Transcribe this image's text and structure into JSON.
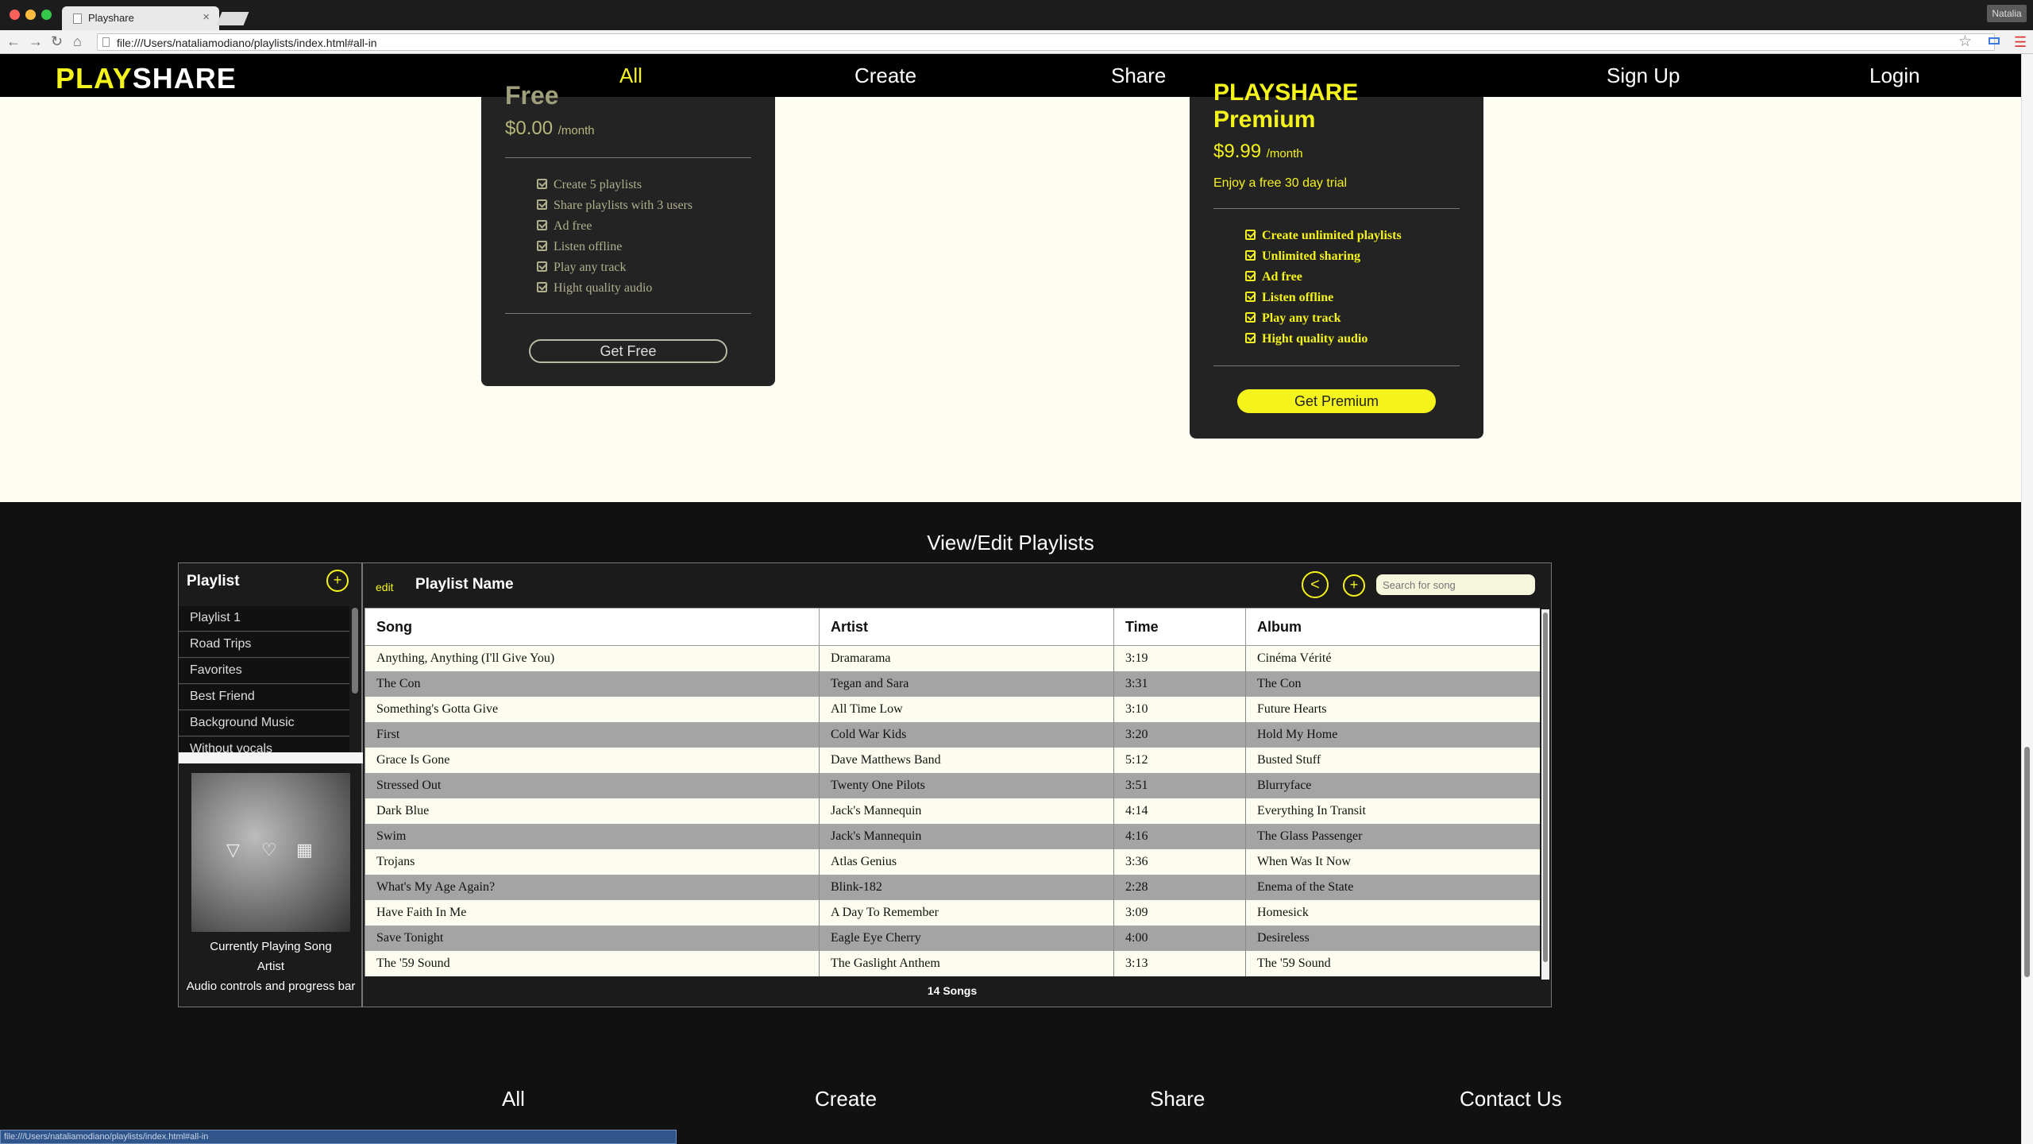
{
  "browser": {
    "tab_title": "Playshare",
    "tab_close": "×",
    "url": "file:///Users/nataliamodiano/playlists/index.html#all-in",
    "profile_name": "Natalia",
    "back_icon": "←",
    "forward_icon": "→",
    "reload_icon": "↻",
    "home_icon": "⌂",
    "star_icon": "☆",
    "menu_icon": "☰",
    "status_url": "file:///Users/nataliamodiano/playlists/index.html#all-in"
  },
  "nav": {
    "logo_part1": "PLAY",
    "logo_part2": "SHARE",
    "links": [
      "All",
      "Create",
      "Share"
    ],
    "signup": "Sign Up",
    "login": "Login",
    "active_color": "#f4f31c"
  },
  "pricing": {
    "free": {
      "title": "Free",
      "price": "$0.00",
      "period": "/month",
      "features": [
        "Create 5 playlists",
        "Share playlists with 3 users",
        "Ad free",
        "Listen offline",
        "Play any track",
        "Hight quality audio"
      ],
      "button": "Get Free"
    },
    "premium": {
      "title_line1": "PLAYSHARE",
      "title_line2": "Premium",
      "price": "$9.99",
      "period": "/month",
      "trial": "Enjoy a free 30 day trial",
      "features": [
        "Create unlimited playlists",
        "Unlimited sharing",
        "Ad free",
        "Listen offline",
        "Play any track",
        "Hight quality audio"
      ],
      "button": "Get Premium"
    }
  },
  "playlists": {
    "heading": "View/Edit Playlists",
    "sidebar_title": "Playlist",
    "add_icon": "+",
    "items": [
      "Playlist 1",
      "Road Trips",
      "Favorites",
      "Best Friend",
      "Background Music",
      "Without vocals"
    ],
    "now_playing": {
      "song": "Currently Playing Song",
      "artist": "Artist",
      "controls": "Audio controls and progress bar"
    },
    "edit_label": "edit",
    "playlist_name": "Playlist Name",
    "search_placeholder": "Search for song",
    "columns": [
      "Song",
      "Artist",
      "Time",
      "Album"
    ],
    "songs": [
      [
        "Anything, Anything (I'll Give You)",
        "Dramarama",
        "3:19",
        "Cinéma Vérité"
      ],
      [
        "The Con",
        "Tegan and Sara",
        "3:31",
        "The Con"
      ],
      [
        "Something's Gotta Give",
        "All Time Low",
        "3:10",
        "Future Hearts"
      ],
      [
        "First",
        "Cold War Kids",
        "3:20",
        "Hold My Home"
      ],
      [
        "Grace Is Gone",
        "Dave Matthews Band",
        "5:12",
        "Busted Stuff"
      ],
      [
        "Stressed Out",
        "Twenty One Pilots",
        "3:51",
        "Blurryface"
      ],
      [
        "Dark Blue",
        "Jack's Mannequin",
        "4:14",
        "Everything In Transit"
      ],
      [
        "Swim",
        "Jack's Mannequin",
        "4:16",
        "The Glass Passenger"
      ],
      [
        "Trojans",
        "Atlas Genius",
        "3:36",
        "When Was It Now"
      ],
      [
        "What's My Age Again?",
        "Blink-182",
        "2:28",
        "Enema of the State"
      ],
      [
        "Have Faith In Me",
        "A Day To Remember",
        "3:09",
        "Homesick"
      ],
      [
        "Save Tonight",
        "Eagle Eye Cherry",
        "4:00",
        "Desireless"
      ],
      [
        "The '59 Sound",
        "The Gaslight Anthem",
        "3:13",
        "The '59 Sound"
      ]
    ],
    "song_count": "14 Songs"
  },
  "footer": {
    "links": [
      "All",
      "Create",
      "Share",
      "Contact Us"
    ]
  }
}
